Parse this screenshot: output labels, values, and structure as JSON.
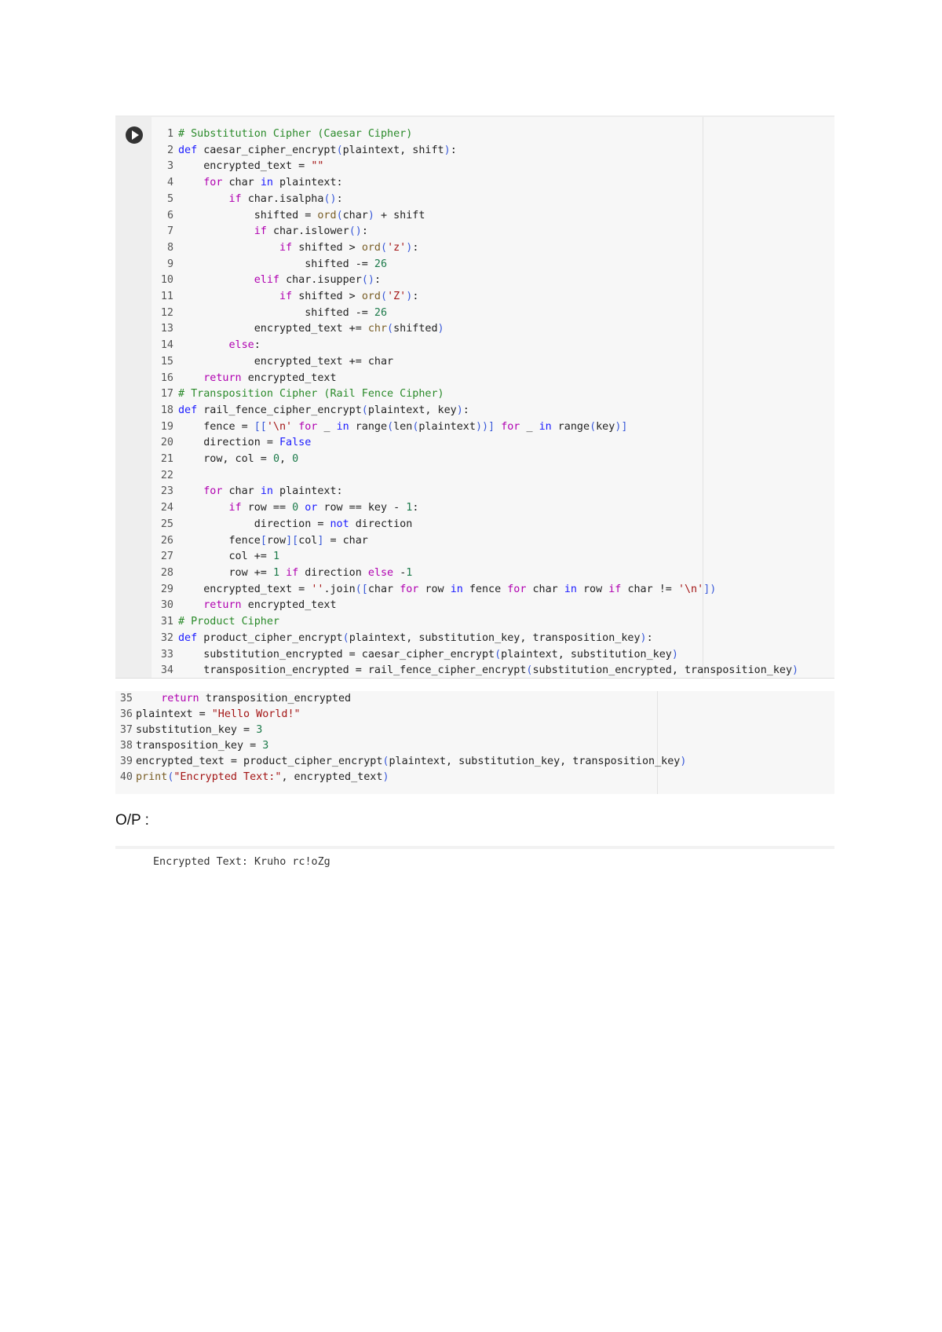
{
  "cell1": {
    "lines": [
      {
        "n": "1",
        "tokens": [
          [
            "# Substitution Cipher (Caesar Cipher)",
            "c"
          ]
        ]
      },
      {
        "n": "2",
        "tokens": [
          [
            "def ",
            "k"
          ],
          [
            "caesar_cipher_encrypt",
            ""
          ],
          [
            "(",
            "b"
          ],
          [
            "plaintext, shift",
            ""
          ],
          [
            ")",
            "b"
          ],
          [
            ":",
            ""
          ]
        ]
      },
      {
        "n": "3",
        "tokens": [
          [
            "    encrypted_text = ",
            ""
          ],
          [
            "\"\"",
            "s"
          ]
        ]
      },
      {
        "n": "4",
        "tokens": [
          [
            "    ",
            ""
          ],
          [
            "for ",
            "p"
          ],
          [
            "char ",
            ""
          ],
          [
            "in ",
            "k"
          ],
          [
            "plaintext:",
            ""
          ]
        ]
      },
      {
        "n": "5",
        "tokens": [
          [
            "        ",
            ""
          ],
          [
            "if ",
            "p"
          ],
          [
            "char.isalpha",
            ""
          ],
          [
            "()",
            "b"
          ],
          [
            ":",
            ""
          ]
        ]
      },
      {
        "n": "6",
        "tokens": [
          [
            "            shifted = ",
            ""
          ],
          [
            "ord",
            "f"
          ],
          [
            "(",
            "b"
          ],
          [
            "char",
            ""
          ],
          [
            ")",
            "b"
          ],
          [
            " + shift",
            ""
          ]
        ]
      },
      {
        "n": "7",
        "tokens": [
          [
            "            ",
            ""
          ],
          [
            "if ",
            "p"
          ],
          [
            "char.islower",
            ""
          ],
          [
            "()",
            "b"
          ],
          [
            ":",
            ""
          ]
        ]
      },
      {
        "n": "8",
        "tokens": [
          [
            "                ",
            ""
          ],
          [
            "if ",
            "p"
          ],
          [
            "shifted > ",
            ""
          ],
          [
            "ord",
            "f"
          ],
          [
            "(",
            "b"
          ],
          [
            "'z'",
            "s"
          ],
          [
            ")",
            "b"
          ],
          [
            ":",
            ""
          ]
        ]
      },
      {
        "n": "9",
        "tokens": [
          [
            "                    shifted -= ",
            ""
          ],
          [
            "26",
            "n"
          ]
        ]
      },
      {
        "n": "10",
        "tokens": [
          [
            "            ",
            ""
          ],
          [
            "elif ",
            "p"
          ],
          [
            "char.isupper",
            ""
          ],
          [
            "()",
            "b"
          ],
          [
            ":",
            ""
          ]
        ]
      },
      {
        "n": "11",
        "tokens": [
          [
            "                ",
            ""
          ],
          [
            "if ",
            "p"
          ],
          [
            "shifted > ",
            ""
          ],
          [
            "ord",
            "f"
          ],
          [
            "(",
            "b"
          ],
          [
            "'Z'",
            "s"
          ],
          [
            ")",
            "b"
          ],
          [
            ":",
            ""
          ]
        ]
      },
      {
        "n": "12",
        "tokens": [
          [
            "                    shifted -= ",
            ""
          ],
          [
            "26",
            "n"
          ]
        ]
      },
      {
        "n": "13",
        "tokens": [
          [
            "            encrypted_text += ",
            ""
          ],
          [
            "chr",
            "f"
          ],
          [
            "(",
            "b"
          ],
          [
            "shifted",
            ""
          ],
          [
            ")",
            "b"
          ]
        ]
      },
      {
        "n": "14",
        "tokens": [
          [
            "        ",
            ""
          ],
          [
            "else",
            "p"
          ],
          [
            ":",
            ""
          ]
        ]
      },
      {
        "n": "15",
        "tokens": [
          [
            "            encrypted_text += char",
            ""
          ]
        ]
      },
      {
        "n": "16",
        "tokens": [
          [
            "    ",
            ""
          ],
          [
            "return ",
            "p"
          ],
          [
            "encrypted_text",
            ""
          ]
        ]
      },
      {
        "n": "17",
        "tokens": [
          [
            "# Transposition Cipher (Rail Fence Cipher)",
            "c"
          ]
        ]
      },
      {
        "n": "18",
        "tokens": [
          [
            "def ",
            "k"
          ],
          [
            "rail_fence_cipher_encrypt",
            ""
          ],
          [
            "(",
            "b"
          ],
          [
            "plaintext, key",
            ""
          ],
          [
            ")",
            "b"
          ],
          [
            ":",
            ""
          ]
        ]
      },
      {
        "n": "19",
        "tokens": [
          [
            "    fence = ",
            ""
          ],
          [
            "[[",
            "b"
          ],
          [
            "'\\n' ",
            "s"
          ],
          [
            "for ",
            "p"
          ],
          [
            "_ ",
            ""
          ],
          [
            "in ",
            "k"
          ],
          [
            "range",
            ""
          ],
          [
            "(",
            "b"
          ],
          [
            "len",
            ""
          ],
          [
            "(",
            "b"
          ],
          [
            "plaintext",
            ""
          ],
          [
            "))]",
            "b"
          ],
          [
            " ",
            ""
          ],
          [
            "for ",
            "p"
          ],
          [
            "_ ",
            ""
          ],
          [
            "in ",
            "k"
          ],
          [
            "range",
            ""
          ],
          [
            "(",
            "b"
          ],
          [
            "key",
            ""
          ],
          [
            ")]",
            "b"
          ]
        ]
      },
      {
        "n": "20",
        "tokens": [
          [
            "    direction = ",
            ""
          ],
          [
            "False",
            "k"
          ]
        ]
      },
      {
        "n": "21",
        "tokens": [
          [
            "    row, col = ",
            ""
          ],
          [
            "0",
            "n"
          ],
          [
            ", ",
            ""
          ],
          [
            "0",
            "n"
          ]
        ]
      },
      {
        "n": "22",
        "tokens": [
          [
            "",
            ""
          ]
        ]
      },
      {
        "n": "23",
        "tokens": [
          [
            "    ",
            ""
          ],
          [
            "for ",
            "p"
          ],
          [
            "char ",
            ""
          ],
          [
            "in ",
            "k"
          ],
          [
            "plaintext:",
            ""
          ]
        ]
      },
      {
        "n": "24",
        "tokens": [
          [
            "        ",
            ""
          ],
          [
            "if ",
            "p"
          ],
          [
            "row == ",
            ""
          ],
          [
            "0 ",
            "n"
          ],
          [
            "or ",
            "k"
          ],
          [
            "row == key - ",
            ""
          ],
          [
            "1",
            "n"
          ],
          [
            ":",
            ""
          ]
        ]
      },
      {
        "n": "25",
        "tokens": [
          [
            "            direction = ",
            ""
          ],
          [
            "not ",
            "k"
          ],
          [
            "direction",
            ""
          ]
        ]
      },
      {
        "n": "26",
        "tokens": [
          [
            "        fence",
            ""
          ],
          [
            "[",
            "b"
          ],
          [
            "row",
            ""
          ],
          [
            "][",
            "b"
          ],
          [
            "col",
            ""
          ],
          [
            "]",
            "b"
          ],
          [
            " = char",
            ""
          ]
        ]
      },
      {
        "n": "27",
        "tokens": [
          [
            "        col += ",
            ""
          ],
          [
            "1",
            "n"
          ]
        ]
      },
      {
        "n": "28",
        "tokens": [
          [
            "        row += ",
            ""
          ],
          [
            "1 ",
            "n"
          ],
          [
            "if ",
            "p"
          ],
          [
            "direction ",
            ""
          ],
          [
            "else ",
            "p"
          ],
          [
            "-",
            ""
          ],
          [
            "1",
            "n"
          ]
        ]
      },
      {
        "n": "29",
        "tokens": [
          [
            "    encrypted_text = ",
            ""
          ],
          [
            "''",
            "s"
          ],
          [
            ".join",
            ""
          ],
          [
            "([",
            "b"
          ],
          [
            "char ",
            ""
          ],
          [
            "for ",
            "p"
          ],
          [
            "row ",
            ""
          ],
          [
            "in ",
            "k"
          ],
          [
            "fence ",
            ""
          ],
          [
            "for ",
            "p"
          ],
          [
            "char ",
            ""
          ],
          [
            "in ",
            "k"
          ],
          [
            "row ",
            ""
          ],
          [
            "if ",
            "p"
          ],
          [
            "char != ",
            ""
          ],
          [
            "'\\n'",
            "s"
          ],
          [
            "])",
            "b"
          ]
        ]
      },
      {
        "n": "30",
        "tokens": [
          [
            "    ",
            ""
          ],
          [
            "return ",
            "p"
          ],
          [
            "encrypted_text",
            ""
          ]
        ]
      },
      {
        "n": "31",
        "tokens": [
          [
            "# Product Cipher",
            "c"
          ]
        ]
      },
      {
        "n": "32",
        "tokens": [
          [
            "def ",
            "k"
          ],
          [
            "product_cipher_encrypt",
            ""
          ],
          [
            "(",
            "b"
          ],
          [
            "plaintext, substitution_key, transposition_key",
            ""
          ],
          [
            ")",
            "b"
          ],
          [
            ":",
            ""
          ]
        ]
      },
      {
        "n": "33",
        "tokens": [
          [
            "    substitution_encrypted = caesar_cipher_encrypt",
            ""
          ],
          [
            "(",
            "b"
          ],
          [
            "plaintext, substitution_key",
            ""
          ],
          [
            ")",
            "b"
          ]
        ]
      },
      {
        "n": "34",
        "tokens": [
          [
            "    transposition_encrypted = rail_fence_cipher_encrypt",
            ""
          ],
          [
            "(",
            "b"
          ],
          [
            "substitution_encrypted, transposition_key",
            ""
          ],
          [
            ")",
            "b"
          ]
        ]
      }
    ]
  },
  "cell2": {
    "lines": [
      {
        "n": "35",
        "tokens": [
          [
            "    ",
            ""
          ],
          [
            "return ",
            "p"
          ],
          [
            "transposition_encrypted",
            ""
          ]
        ]
      },
      {
        "n": "36",
        "tokens": [
          [
            "plaintext = ",
            ""
          ],
          [
            "\"Hello World!\"",
            "s"
          ]
        ]
      },
      {
        "n": "37",
        "tokens": [
          [
            "substitution_key = ",
            ""
          ],
          [
            "3",
            "n"
          ]
        ]
      },
      {
        "n": "38",
        "tokens": [
          [
            "transposition_key = ",
            ""
          ],
          [
            "3",
            "n"
          ]
        ]
      },
      {
        "n": "39",
        "tokens": [
          [
            "encrypted_text = product_cipher_encrypt",
            ""
          ],
          [
            "(",
            "b"
          ],
          [
            "plaintext, substitution_key, transposition_key",
            ""
          ],
          [
            ")",
            "b"
          ]
        ]
      },
      {
        "n": "40",
        "tokens": [
          [
            "print",
            "f"
          ],
          [
            "(",
            "b"
          ],
          [
            "\"Encrypted Text:\"",
            "s"
          ],
          [
            ", encrypted_text",
            ""
          ],
          [
            ")",
            "b"
          ]
        ]
      }
    ]
  },
  "output": {
    "label": "O/P :",
    "text": "Encrypted Text: Kruho rc!oZg"
  }
}
